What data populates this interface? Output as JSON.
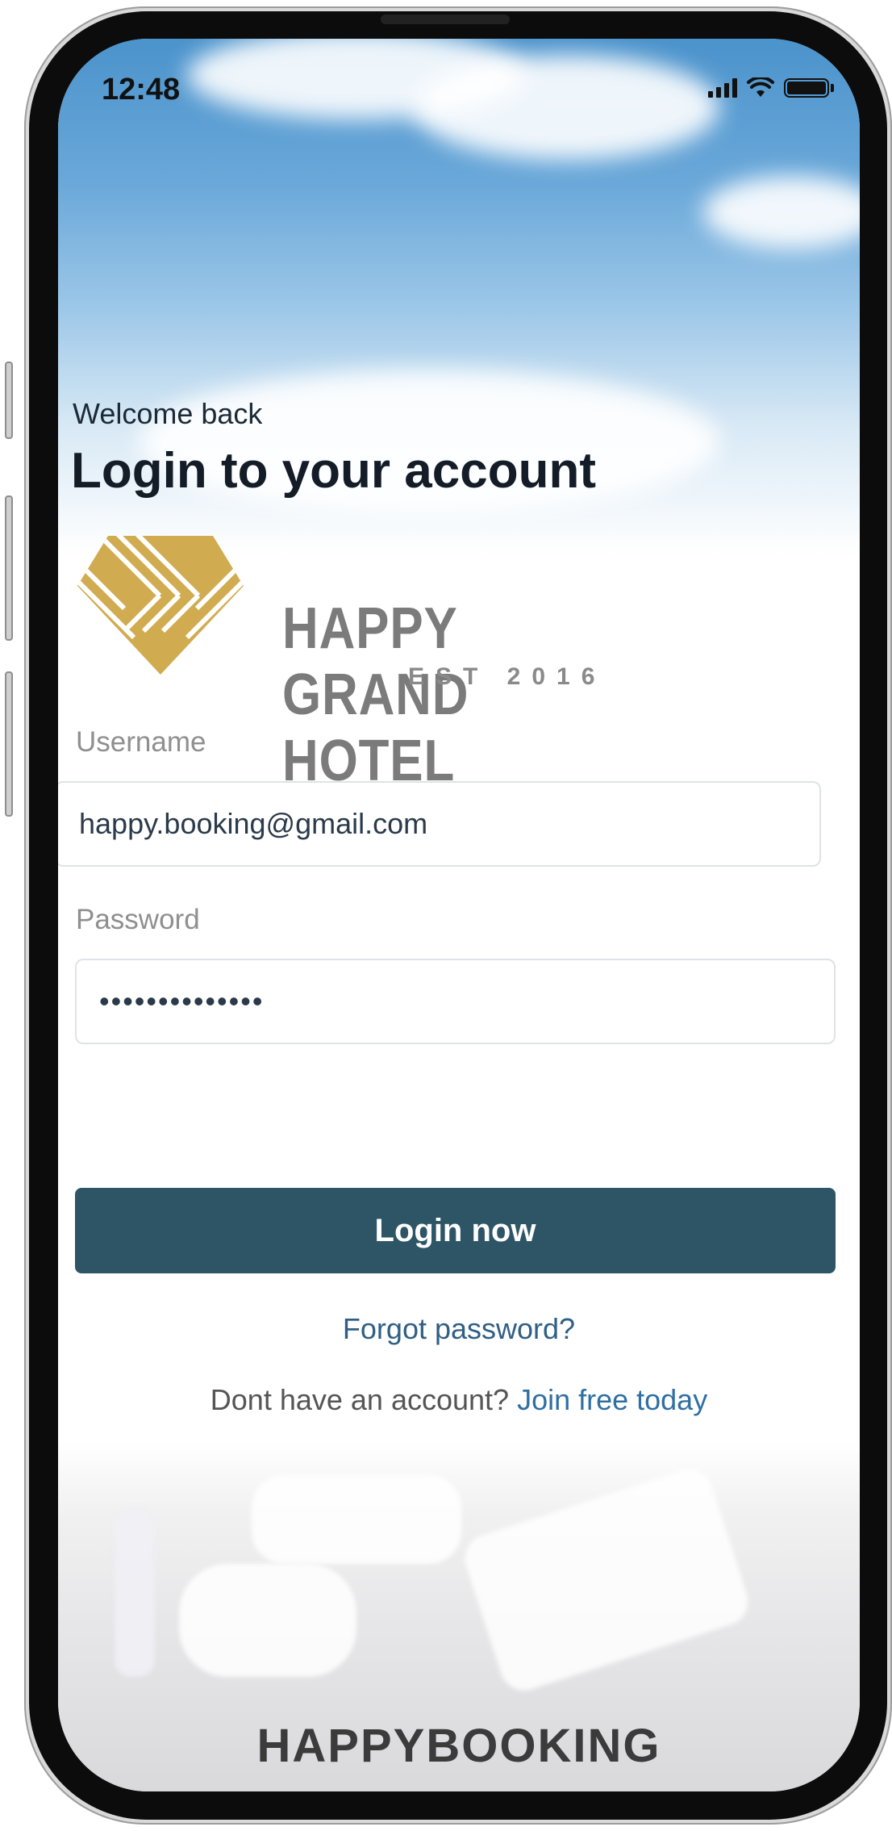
{
  "status_bar": {
    "time": "12:48",
    "signal_icon": "cellular-signal-icon",
    "wifi_icon": "wifi-icon",
    "battery_icon": "battery-icon"
  },
  "header": {
    "welcome": "Welcome back",
    "title": "Login to your account"
  },
  "logo": {
    "name": "HAPPY GRAND HOTEL",
    "established": "EST 2016",
    "brand_color": "#d1ab4f"
  },
  "form": {
    "username_label": "Username",
    "username_value": "happy.booking@gmail.com",
    "password_label": "Password",
    "password_value": "••••••••••••••"
  },
  "actions": {
    "login_label": "Login now",
    "forgot_label": "Forgot password?",
    "signup_prompt": "Dont have an account?",
    "signup_link": "Join free today"
  },
  "footer": {
    "brand": "HAPPYBOOKING"
  },
  "colors": {
    "primary": "#2e5566",
    "link": "#2f6fa3"
  }
}
